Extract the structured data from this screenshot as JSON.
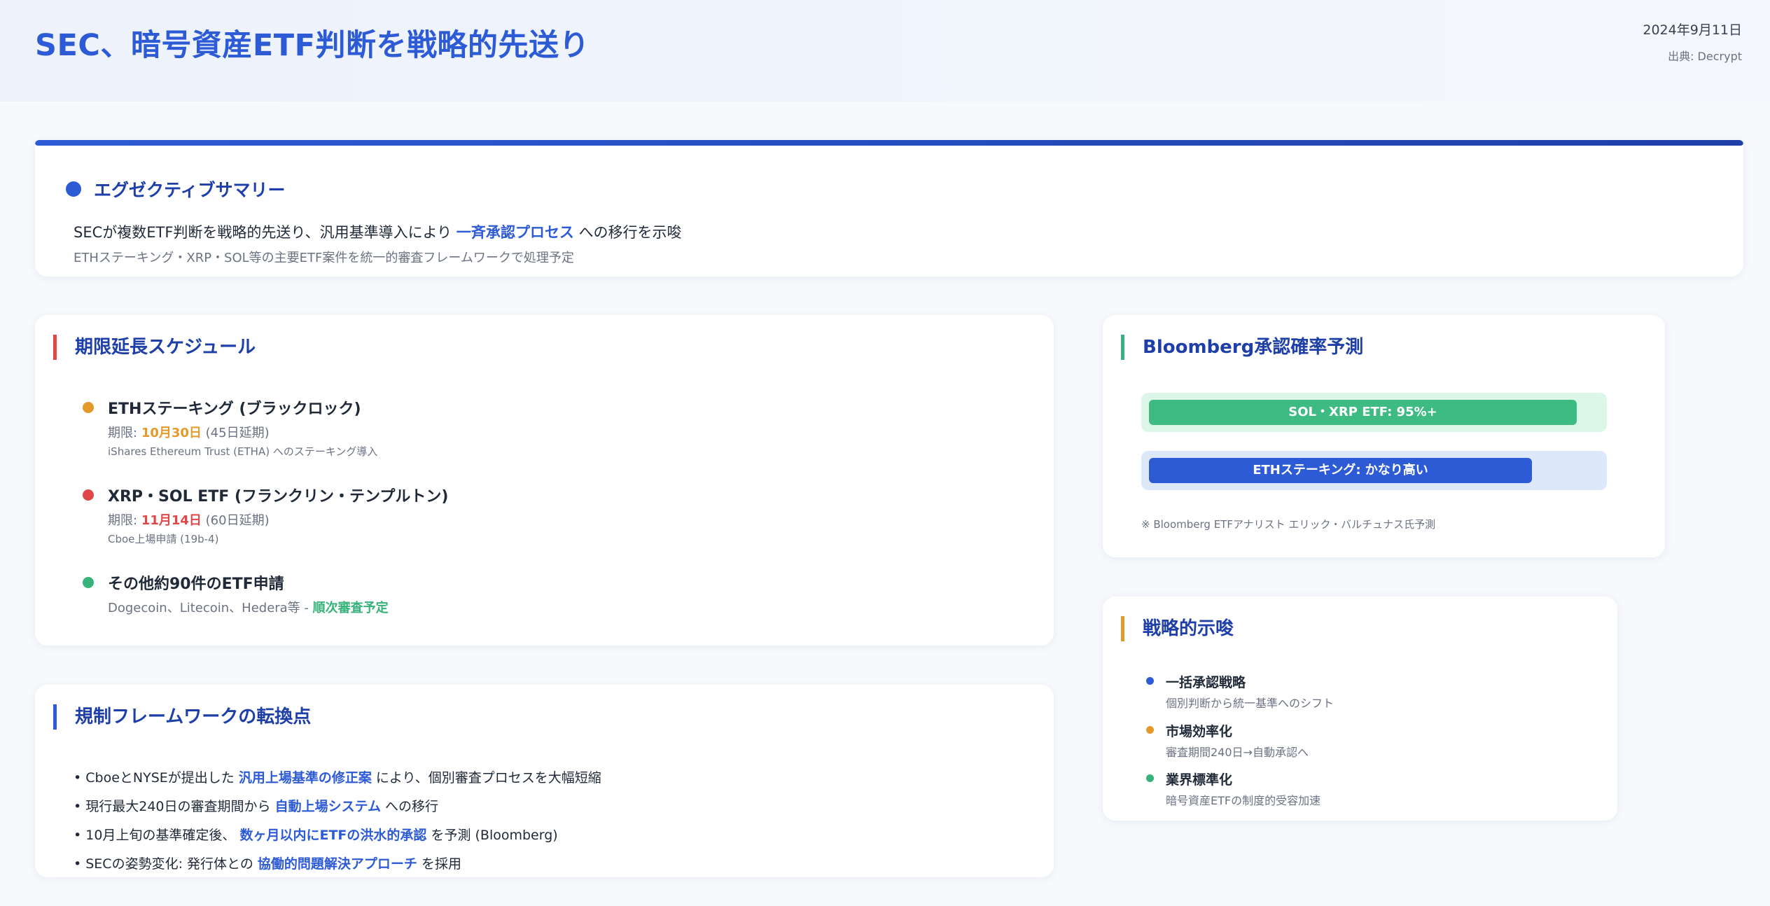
{
  "header": {
    "title": "SEC、暗号資産ETF判断を戦略的先送り",
    "date": "2024年9月11日",
    "source": "出典: Decrypt"
  },
  "summary": {
    "title": "エグゼクティブサマリー",
    "main_before": "SECが複数ETF判断を戦略的先送り、汎用基準導入により",
    "main_highlight": "一斉承認プロセス",
    "main_after": "への移行を示唆",
    "sub": "ETHステーキング・XRP・SOL等の主要ETF案件を統一的審査フレームワークで処理予定"
  },
  "schedule": {
    "title": "期限延長スケジュール",
    "items": [
      {
        "name": "ETHステーキング (ブラックロック)",
        "deadline_label": "期限:",
        "deadline": "10月30日",
        "extension": "(45日延期)",
        "note": "iShares Ethereum Trust (ETHA) へのステーキング導入"
      },
      {
        "name": "XRP・SOL ETF (フランクリン・テンプルトン)",
        "deadline_label": "期限:",
        "deadline": "11月14日",
        "extension": "(60日延期)",
        "note": "Cboe上場申請 (19b-4)"
      },
      {
        "name": "その他約90件のETF申請",
        "desc": "Dogecoin、Litecoin、Hedera等 -",
        "status": "順次審査予定"
      }
    ]
  },
  "framework": {
    "title": "規制フレームワークの転換点",
    "items": [
      {
        "before": "• CboeとNYSEが提出した",
        "highlight": "汎用上場基準の修正案",
        "after": "により、個別審査プロセスを大幅短縮"
      },
      {
        "before": "• 現行最大240日の審査期間から",
        "highlight": "自動上場システム",
        "after": "への移行"
      },
      {
        "before": "• 10月上旬の基準確定後、",
        "highlight": "数ヶ月以内にETFの洪水的承認",
        "after": "を予測 (Bloomberg)"
      },
      {
        "before": "• SECの姿勢変化: 発行体との",
        "highlight": "協働的問題解決アプローチ",
        "after": "を採用"
      }
    ]
  },
  "bloomberg": {
    "title": "Bloomberg承認確率予測",
    "bars": [
      {
        "label": "SOL・XRP ETF: 95%+",
        "level": 0.95,
        "fill_color": "#3dbb82",
        "track_color": "#dcf7e7"
      },
      {
        "label": "ETHステーキング: かなり高い",
        "level": 0.85,
        "fill_color": "#2d5bd6",
        "track_color": "#dce8fa"
      }
    ],
    "note": "※ Bloomberg ETFアナリスト エリック・バルチュナス氏予測"
  },
  "strategy": {
    "title": "戦略的示唆",
    "items": [
      {
        "name": "一括承認戦略",
        "desc": "個別判断から統一基準へのシフト"
      },
      {
        "name": "市場効率化",
        "desc": "審査期間240日→自動承認へ"
      },
      {
        "name": "業界標準化",
        "desc": "暗号資産ETFの制度的受容加速"
      }
    ]
  },
  "colors": {
    "primary": "#2d5bd6",
    "navy": "#1e3fa8",
    "orange": "#e39a2a",
    "red": "#e04848",
    "green": "#37b27a"
  }
}
